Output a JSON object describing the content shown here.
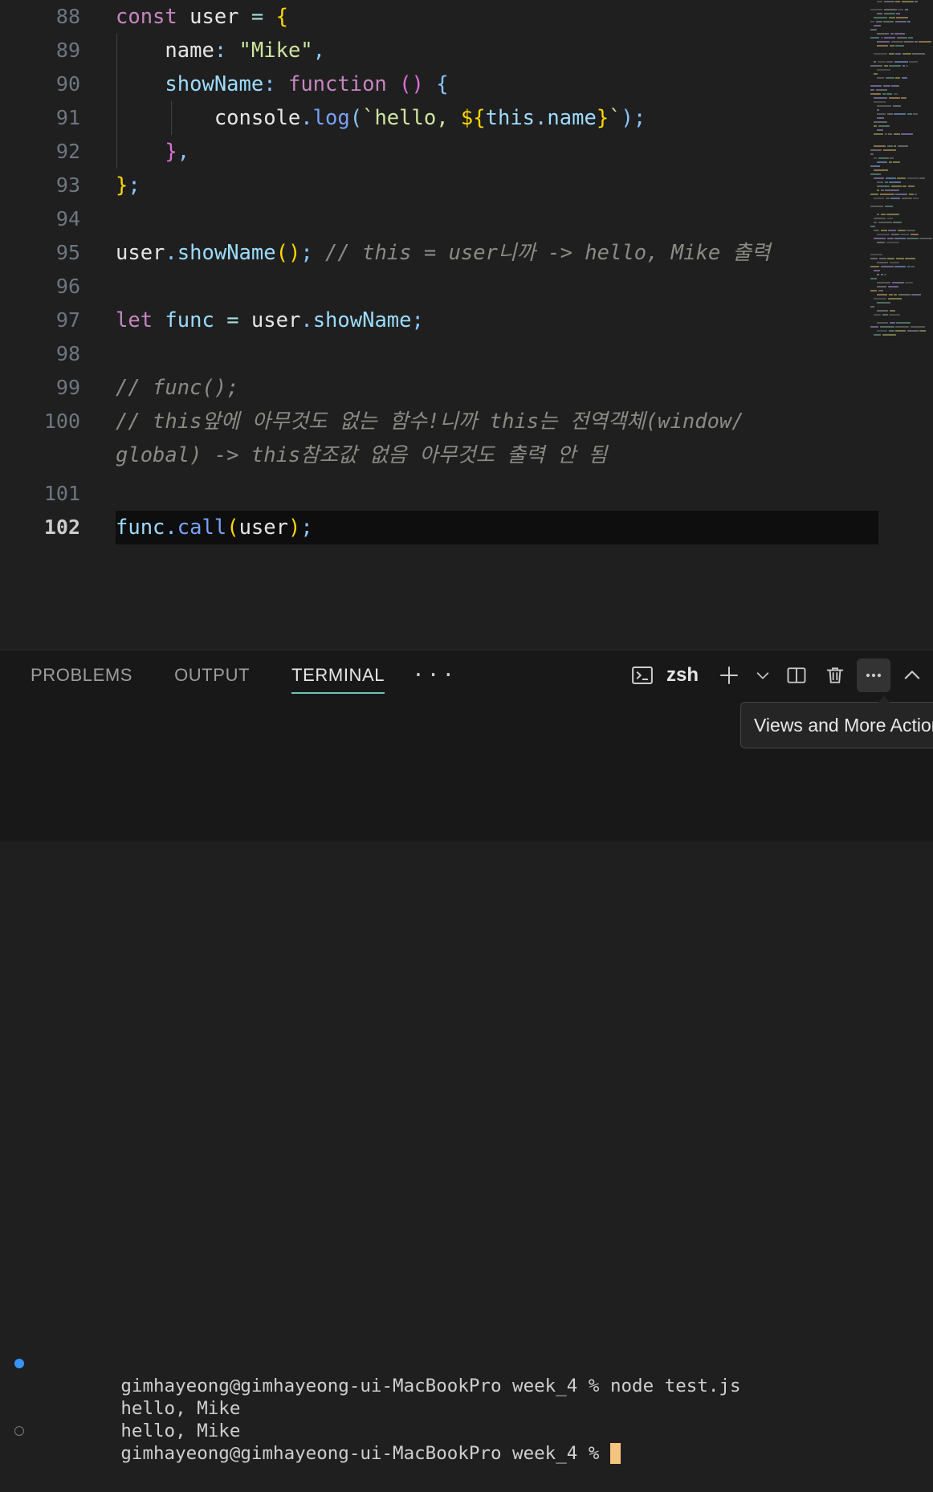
{
  "app": "vscode",
  "colors": {
    "editor_bg": "#1f1f1f",
    "panel_bg": "#181818",
    "accent_tab_underline": "#6fc3bb",
    "terminal_cursor": "#f5c57f",
    "prompt_success": "#3794ff",
    "line_number": "#6e7681",
    "active_line_number": "#cccccc"
  },
  "editor": {
    "first_line_number": 88,
    "active_line_number": 102,
    "lines": [
      {
        "number": 88,
        "text": "const user = {"
      },
      {
        "number": 89,
        "text": "    name: \"Mike\","
      },
      {
        "number": 90,
        "text": "    showName: function () {"
      },
      {
        "number": 91,
        "text": "        console.log(`hello, ${this.name}`);"
      },
      {
        "number": 92,
        "text": "    },"
      },
      {
        "number": 93,
        "text": "};"
      },
      {
        "number": 94,
        "text": ""
      },
      {
        "number": 95,
        "text": "user.showName(); // this = user니까 -> hello, Mike 출력"
      },
      {
        "number": 96,
        "text": ""
      },
      {
        "number": 97,
        "text": "let func = user.showName;"
      },
      {
        "number": 98,
        "text": ""
      },
      {
        "number": 99,
        "text": "// func();"
      },
      {
        "number": 100,
        "text": "// this앞에 아무것도 없는 함수!니까 this는 전역객체(window/global) -> this참조값 없음 아무것도 출력 안 됨"
      },
      {
        "number": 101,
        "text": ""
      },
      {
        "number": 102,
        "text": "func.call(user);"
      }
    ],
    "line_95_comment": "// this = user니까 -> hello, Mike 출력",
    "line_99_comment": "// func();",
    "line_100_comment_part1": "// this앞에 아무것도 없는 함수!니까 this는 전역객체(window/",
    "line_100_comment_part2": "global) -> this참조값 없음 아무것도 출력 안 됨"
  },
  "minimap": {
    "name": "minimap",
    "visible": true
  },
  "panel": {
    "tabs": [
      {
        "label": "PROBLEMS",
        "active": false
      },
      {
        "label": "OUTPUT",
        "active": false
      },
      {
        "label": "TERMINAL",
        "active": true
      }
    ],
    "more_tabs_label": "···",
    "actions": {
      "shell_name": "zsh",
      "new_terminal_label": "+",
      "more_actions_label": "···"
    },
    "tooltip": {
      "text": "Views and More Actions...",
      "visible": true
    }
  },
  "terminal": {
    "lines": [
      {
        "decoration": "success",
        "prompt": "gimhayeong@gimhayeong-ui-MacBookPro week_4 % ",
        "command": "node test.js"
      },
      {
        "decoration": "none",
        "prompt": "",
        "command": "hello, Mike"
      },
      {
        "decoration": "none",
        "prompt": "",
        "command": "hello, Mike"
      },
      {
        "decoration": "pending",
        "prompt": "gimhayeong@gimhayeong-ui-MacBookPro week_4 % ",
        "command": "",
        "cursor": true
      }
    ],
    "output_text": "hello, Mike",
    "user_host": "gimhayeong@gimhayeong-ui-MacBookPro",
    "cwd": "week_4",
    "prompt_symbol": "%"
  }
}
